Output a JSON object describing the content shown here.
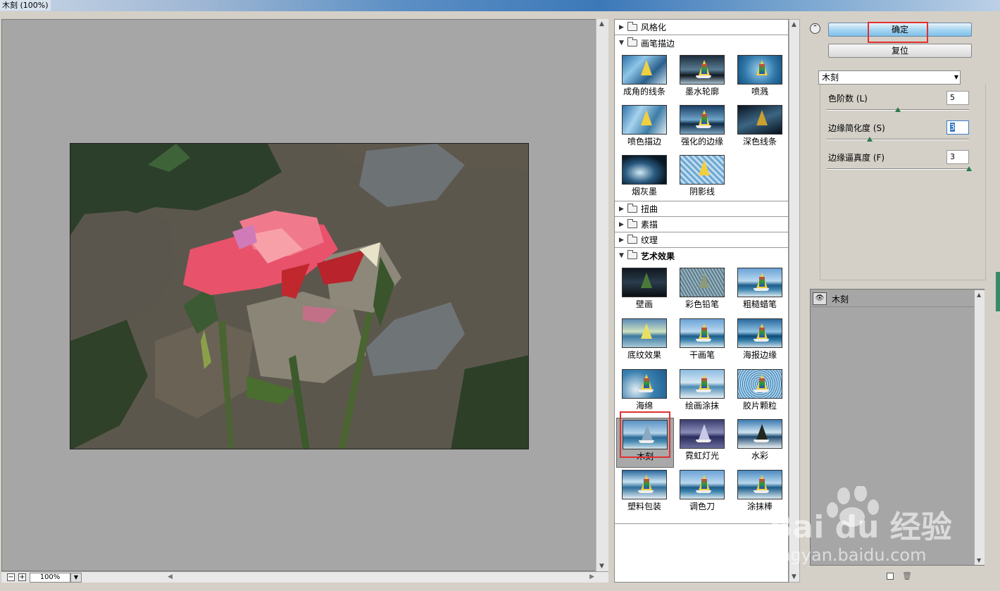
{
  "window": {
    "title": "木刻 (100%)"
  },
  "preview": {
    "zoom": "100%"
  },
  "gallery": {
    "categories": [
      {
        "name": "风格化",
        "expanded": false
      },
      {
        "name": "画笔描边",
        "expanded": true,
        "items": [
          "成角的线条",
          "墨水轮廓",
          "喷溅",
          "喷色描边",
          "强化的边缘",
          "深色线条",
          "烟灰墨",
          "阴影线"
        ]
      },
      {
        "name": "扭曲",
        "expanded": false
      },
      {
        "name": "素描",
        "expanded": false
      },
      {
        "name": "纹理",
        "expanded": false
      },
      {
        "name": "艺术效果",
        "expanded": true,
        "items": [
          "壁画",
          "彩色铅笔",
          "粗糙蜡笔",
          "底纹效果",
          "干画笔",
          "海报边缘",
          "海绵",
          "绘画涂抹",
          "胶片颗粒",
          "木刻",
          "霓虹灯光",
          "水彩",
          "塑料包装",
          "调色刀",
          "涂抹棒"
        ]
      }
    ],
    "selected": "木刻"
  },
  "controls": {
    "ok_label": "确定",
    "reset_label": "复位",
    "filter_select": "木刻",
    "params": [
      {
        "label": "色阶数 (L)",
        "value": "5",
        "fraction": 0.5
      },
      {
        "label": "边缘简化度 (S)",
        "value": "3",
        "fraction": 0.3
      },
      {
        "label": "边缘逼真度 (F)",
        "value": "3",
        "fraction": 1.0
      }
    ]
  },
  "layers": {
    "items": [
      {
        "name": "木刻",
        "visible": true
      }
    ]
  },
  "watermark": {
    "brand": "Bai du 经验",
    "url": "jingyan.baidu.com"
  },
  "colors": {
    "accent": "#7fc0ea",
    "highlight": "#e03030"
  }
}
